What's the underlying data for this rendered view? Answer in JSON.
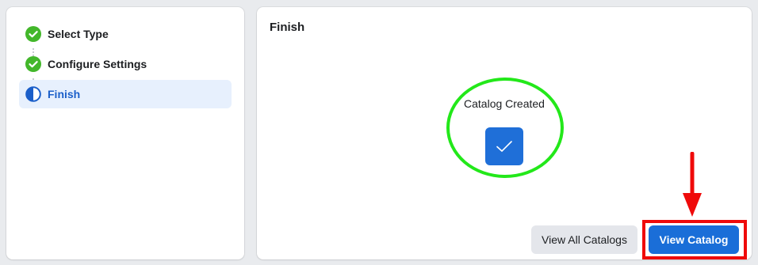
{
  "steps": [
    {
      "label": "Select Type",
      "state": "complete"
    },
    {
      "label": "Configure Settings",
      "state": "complete"
    },
    {
      "label": "Finish",
      "state": "active"
    }
  ],
  "main": {
    "title": "Finish",
    "status_text": "Catalog Created",
    "status_icon": "checkmark-icon"
  },
  "actions": {
    "secondary_label": "View All Catalogs",
    "primary_label": "View Catalog"
  },
  "colors": {
    "accent": "#1a6ed8",
    "complete": "#42b72a",
    "annotation_green": "#23e81a",
    "annotation_red": "#ef0a0a"
  }
}
